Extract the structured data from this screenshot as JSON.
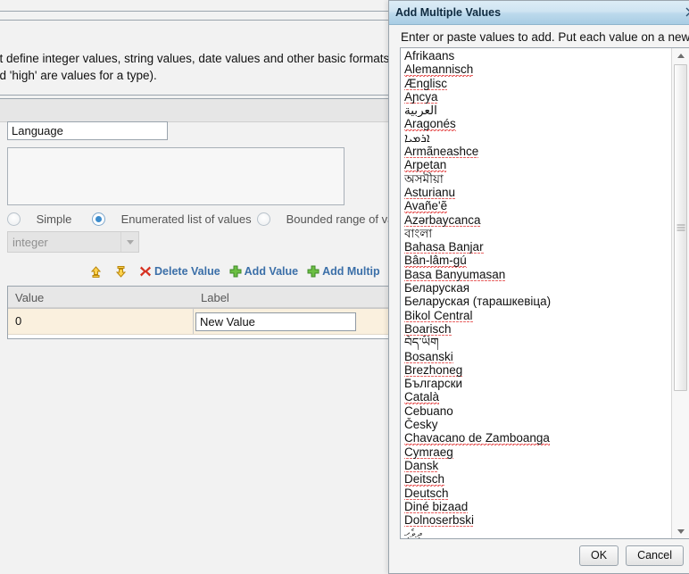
{
  "background_app": {
    "description_line1": "at define integer values, string values, date values and other basic formats of da",
    "description_line2": "nd 'high' are values for a type).",
    "name_field": {
      "value": "Language",
      "placeholder": ""
    },
    "description_field": {
      "value": "",
      "placeholder": ""
    },
    "type_kind_radios": [
      {
        "label": "Simple",
        "checked": false
      },
      {
        "label": "Enumerated list of values",
        "checked": true
      },
      {
        "label": "Bounded range of val",
        "checked": false
      }
    ],
    "base_type_select": {
      "value": "integer",
      "arrow_icon": "chevron-down-icon"
    },
    "actions": [
      {
        "label": "",
        "icon": "move-up-icon"
      },
      {
        "label": "",
        "icon": "move-down-icon"
      },
      {
        "label": "Delete Value",
        "icon": "delete-x-icon"
      },
      {
        "label": "Add Value",
        "icon": "plus-icon"
      },
      {
        "label": "Add Multip",
        "icon": "plus-icon"
      }
    ],
    "values_table": {
      "columns": [
        "Value",
        "Label"
      ],
      "rows": [
        {
          "value": "0",
          "label": "New Value"
        }
      ]
    }
  },
  "dialog": {
    "title": "Add Multiple Values",
    "close_icon": "close-icon",
    "instruction": "Enter or paste values to add. Put each value on a new line.",
    "textarea_lines": [
      {
        "text": "Afrikaans",
        "misspelled": false
      },
      {
        "text": "Alemannisch",
        "misspelled": true
      },
      {
        "text": "Ænglisc",
        "misspelled": true
      },
      {
        "text": "Aɲcya",
        "misspelled": true
      },
      {
        "text": "العربية",
        "misspelled": false
      },
      {
        "text": "Aragonés",
        "misspelled": true
      },
      {
        "text": "ܐܪܡܝܐ",
        "misspelled": false
      },
      {
        "text": "Armãneashce",
        "misspelled": true
      },
      {
        "text": "Arpetan",
        "misspelled": true
      },
      {
        "text": "অসমীয়া",
        "misspelled": false
      },
      {
        "text": "Asturianu",
        "misspelled": true
      },
      {
        "text": "Avañe'ẽ",
        "misspelled": true
      },
      {
        "text": "Azərbaycanca",
        "misspelled": true
      },
      {
        "text": "বাংলা",
        "misspelled": false
      },
      {
        "text": "Bahasa Banjar",
        "misspelled": true
      },
      {
        "text": "Bân-lâm-gú",
        "misspelled": true
      },
      {
        "text": "Basa Banyumasan",
        "misspelled": true
      },
      {
        "text": "Беларуская",
        "misspelled": false
      },
      {
        "text": "Беларуская (тарашкевіца)",
        "misspelled": false
      },
      {
        "text": "Bikol Central",
        "misspelled": true
      },
      {
        "text": "Boarisch",
        "misspelled": true
      },
      {
        "text": "བོད་ཡིག",
        "misspelled": false
      },
      {
        "text": "Bosanski",
        "misspelled": true
      },
      {
        "text": "Brezhoneg",
        "misspelled": true
      },
      {
        "text": "Български",
        "misspelled": false
      },
      {
        "text": "Català",
        "misspelled": true
      },
      {
        "text": "Cebuano",
        "misspelled": false
      },
      {
        "text": "Česky",
        "misspelled": false
      },
      {
        "text": "Chavacano de Zamboanga",
        "misspelled": true
      },
      {
        "text": "Cymraeg",
        "misspelled": true
      },
      {
        "text": "Dansk",
        "misspelled": true
      },
      {
        "text": "Deitsch",
        "misspelled": true
      },
      {
        "text": "Deutsch",
        "misspelled": true
      },
      {
        "text": "Diné bizaad",
        "misspelled": true
      },
      {
        "text": "Dolnoserbski",
        "misspelled": true
      },
      {
        "text": "ދިވެހި",
        "misspelled": false
      }
    ],
    "scrollbar": {
      "up_icon": "scroll-up-icon",
      "down_icon": "scroll-down-icon",
      "grip_icon": "scrollbar-grip-icon"
    },
    "buttons": {
      "ok": "OK",
      "cancel": "Cancel"
    }
  },
  "colors": {
    "title_accent": "#a8cde4",
    "link_blue": "#3b6fa8",
    "row_highlight": "#faf0de",
    "spellcheck_red": "#e03030"
  }
}
